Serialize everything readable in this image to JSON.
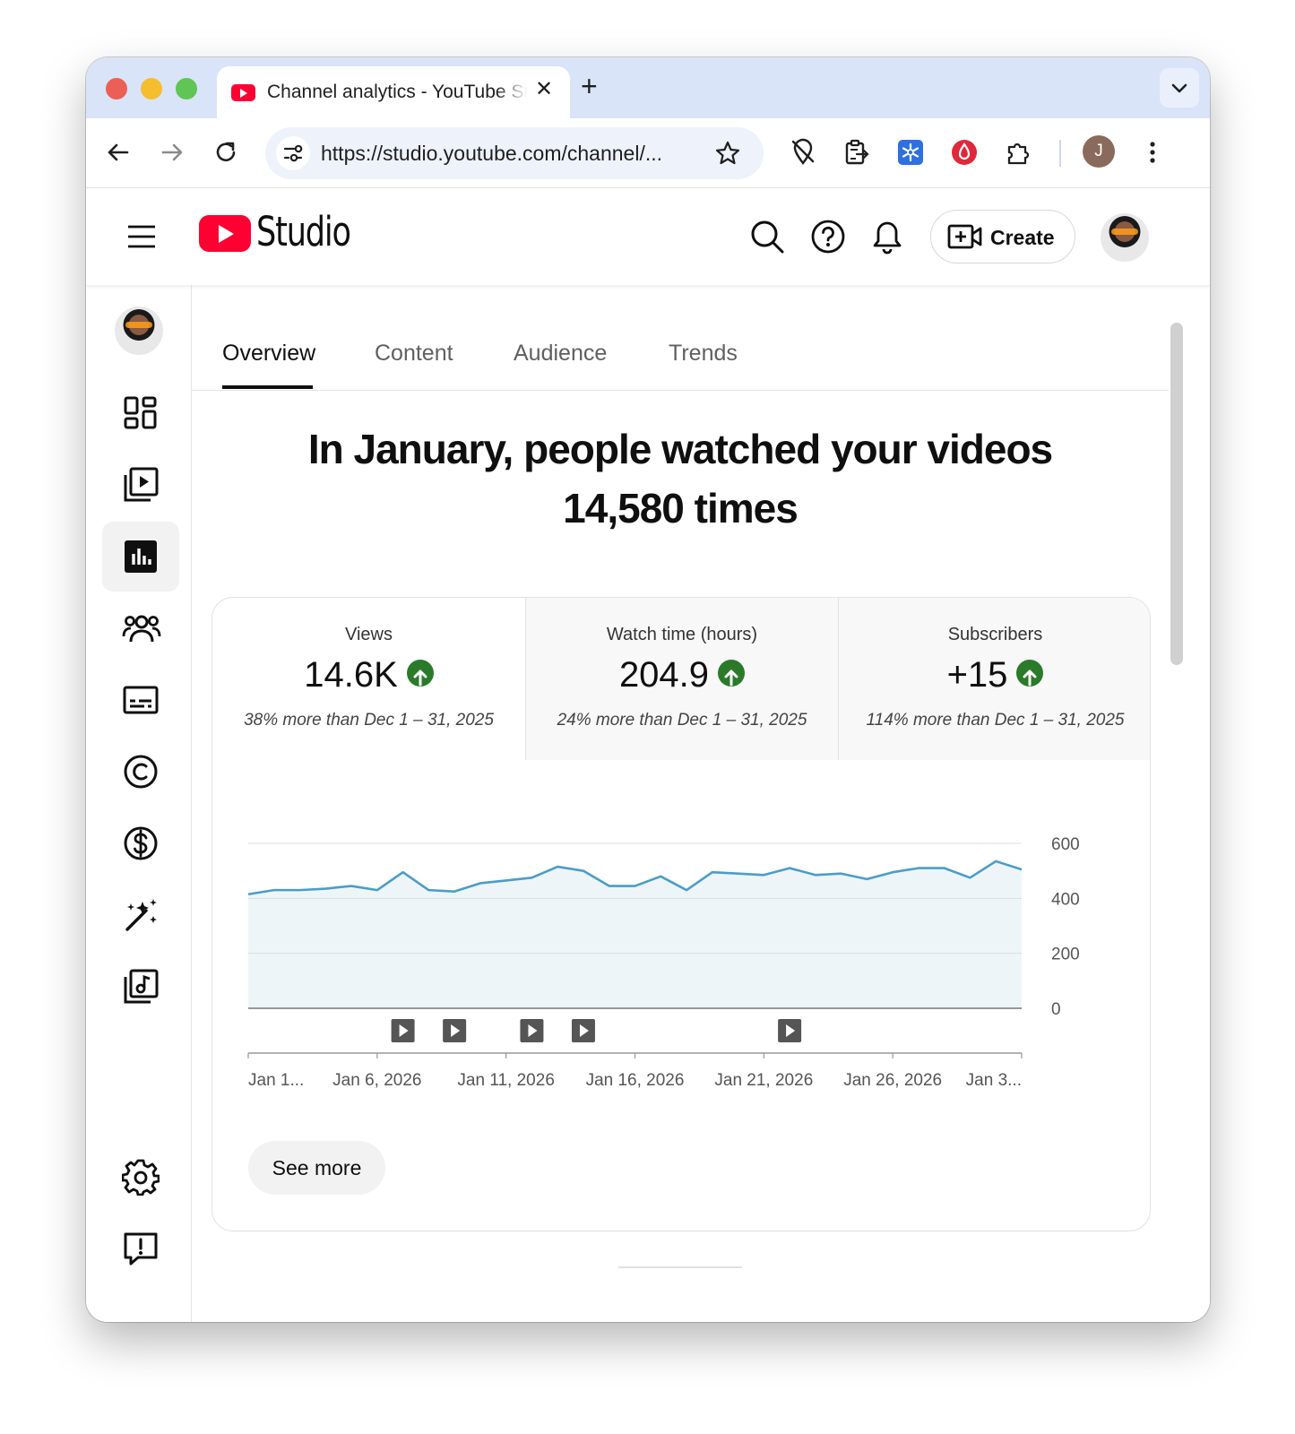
{
  "browser": {
    "tab_title": "Channel analytics - YouTube Studio",
    "url": "https://studio.youtube.com/channel/...",
    "profile_initial": "J"
  },
  "header": {
    "logo_text": "Studio",
    "create_label": "Create"
  },
  "tabs": [
    {
      "label": "Overview",
      "active": true
    },
    {
      "label": "Content",
      "active": false
    },
    {
      "label": "Audience",
      "active": false
    },
    {
      "label": "Trends",
      "active": false
    }
  ],
  "headline": {
    "line1": "In January, people watched your videos",
    "line2": "14,580 times"
  },
  "metrics": [
    {
      "label": "Views",
      "value": "14.6K",
      "trend": "up",
      "comparison": "38% more than Dec 1 – 31, 2025"
    },
    {
      "label": "Watch time (hours)",
      "value": "204.9",
      "trend": "up",
      "comparison": "24% more than Dec 1 – 31, 2025"
    },
    {
      "label": "Subscribers",
      "value": "+15",
      "trend": "up",
      "comparison": "114% more than Dec 1 – 31, 2025"
    }
  ],
  "chart_data": {
    "type": "area",
    "x": [
      "Jan 1",
      "Jan 2",
      "Jan 3",
      "Jan 4",
      "Jan 5",
      "Jan 6",
      "Jan 7",
      "Jan 8",
      "Jan 9",
      "Jan 10",
      "Jan 11",
      "Jan 12",
      "Jan 13",
      "Jan 14",
      "Jan 15",
      "Jan 16",
      "Jan 17",
      "Jan 18",
      "Jan 19",
      "Jan 20",
      "Jan 21",
      "Jan 22",
      "Jan 23",
      "Jan 24",
      "Jan 25",
      "Jan 26",
      "Jan 27",
      "Jan 28",
      "Jan 29",
      "Jan 30",
      "Jan 31"
    ],
    "series": [
      {
        "values": [
          415,
          430,
          430,
          435,
          445,
          430,
          495,
          430,
          425,
          455,
          465,
          475,
          515,
          500,
          445,
          445,
          480,
          430,
          495,
          490,
          485,
          510,
          485,
          490,
          470,
          495,
          510,
          510,
          475,
          535,
          505
        ],
        "color": "#4a9dc9"
      }
    ],
    "ylim": [
      0,
      600
    ],
    "yticks": [
      "600",
      "400",
      "200",
      "0"
    ],
    "xtick_labels": [
      "Jan 1...",
      "Jan 6, 2026",
      "Jan 11, 2026",
      "Jan 16, 2026",
      "Jan 21, 2026",
      "Jan 26, 2026",
      "Jan 3..."
    ],
    "xtick_days": [
      1,
      6,
      11,
      16,
      21,
      26,
      31
    ],
    "video_markers_days": [
      7,
      9,
      12,
      14,
      22
    ],
    "grid": true
  },
  "see_more_label": "See more",
  "colors": {
    "brand": "#ff0033",
    "trend_up": "#2a7a2a",
    "line": "#4a9dc9",
    "area_fill": "#eef5f9"
  }
}
